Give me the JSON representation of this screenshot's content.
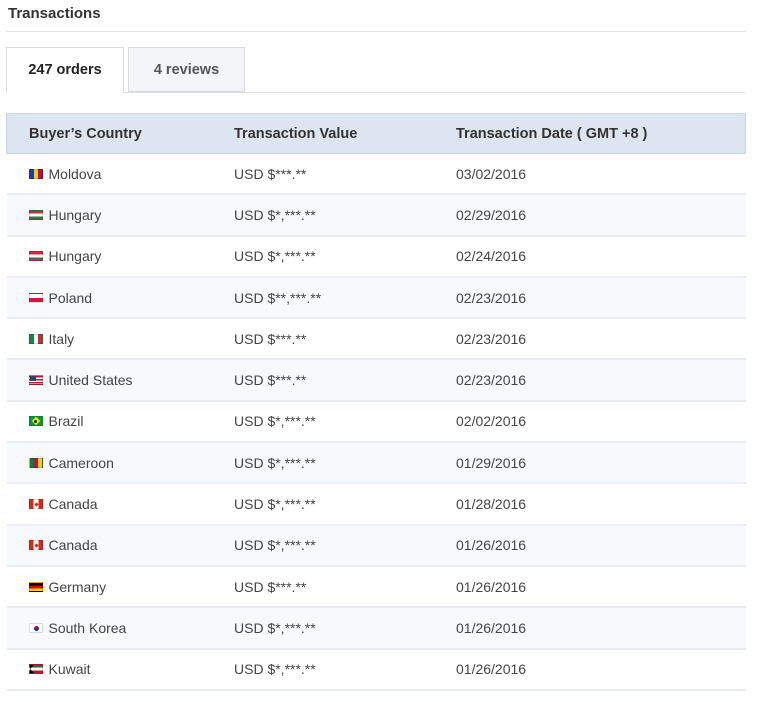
{
  "section": {
    "title": "Transactions"
  },
  "tabs": [
    {
      "label": "247 orders",
      "active": true
    },
    {
      "label": "4 reviews",
      "active": false
    }
  ],
  "table": {
    "headers": [
      "Buyer’s Country",
      "Transaction Value",
      "Transaction Date ( GMT +8 )"
    ],
    "rows": [
      {
        "flag": "md",
        "country": "Moldova",
        "value": "USD $***.**",
        "date": "03/02/2016"
      },
      {
        "flag": "hu",
        "country": "Hungary",
        "value": "USD $*,***.**",
        "date": "02/29/2016"
      },
      {
        "flag": "hu",
        "country": "Hungary",
        "value": "USD $*,***.**",
        "date": "02/24/2016"
      },
      {
        "flag": "pl",
        "country": "Poland",
        "value": "USD $**,***.**",
        "date": "02/23/2016"
      },
      {
        "flag": "it",
        "country": "Italy",
        "value": "USD $***.**",
        "date": "02/23/2016"
      },
      {
        "flag": "us",
        "country": "United States",
        "value": "USD $***.**",
        "date": "02/23/2016"
      },
      {
        "flag": "br",
        "country": "Brazil",
        "value": "USD $*,***.**",
        "date": "02/02/2016"
      },
      {
        "flag": "cm",
        "country": "Cameroon",
        "value": "USD $*,***.**",
        "date": "01/29/2016"
      },
      {
        "flag": "ca",
        "country": "Canada",
        "value": "USD $*,***.**",
        "date": "01/28/2016"
      },
      {
        "flag": "ca",
        "country": "Canada",
        "value": "USD $*,***.**",
        "date": "01/26/2016"
      },
      {
        "flag": "de",
        "country": "Germany",
        "value": "USD $***.**",
        "date": "01/26/2016"
      },
      {
        "flag": "kr",
        "country": "South Korea",
        "value": "USD $*,***.**",
        "date": "01/26/2016"
      },
      {
        "flag": "kw",
        "country": "Kuwait",
        "value": "USD $*,***.**",
        "date": "01/26/2016"
      }
    ]
  }
}
